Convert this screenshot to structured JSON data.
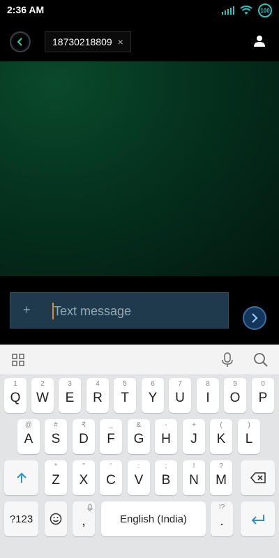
{
  "status": {
    "time": "2:36 AM",
    "battery": "100"
  },
  "header": {
    "recipient": "18730218809",
    "chip_close": "×"
  },
  "compose": {
    "attach": "+",
    "placeholder": "Text message"
  },
  "keyboard": {
    "row1": [
      {
        "main": "Q",
        "hint": "1"
      },
      {
        "main": "W",
        "hint": "2"
      },
      {
        "main": "E",
        "hint": "3"
      },
      {
        "main": "R",
        "hint": "4"
      },
      {
        "main": "T",
        "hint": "5"
      },
      {
        "main": "Y",
        "hint": "6"
      },
      {
        "main": "U",
        "hint": "7"
      },
      {
        "main": "I",
        "hint": "8"
      },
      {
        "main": "O",
        "hint": "9"
      },
      {
        "main": "P",
        "hint": "0"
      }
    ],
    "row2": [
      {
        "main": "A",
        "hint": "@"
      },
      {
        "main": "S",
        "hint": "#"
      },
      {
        "main": "D",
        "hint": "₹"
      },
      {
        "main": "F",
        "hint": "_"
      },
      {
        "main": "G",
        "hint": "&"
      },
      {
        "main": "H",
        "hint": "-"
      },
      {
        "main": "J",
        "hint": "+"
      },
      {
        "main": "K",
        "hint": "("
      },
      {
        "main": "L",
        "hint": ")"
      }
    ],
    "row3": [
      {
        "main": "Z",
        "hint": "*"
      },
      {
        "main": "X",
        "hint": "\""
      },
      {
        "main": "C",
        "hint": "'"
      },
      {
        "main": "V",
        "hint": ":"
      },
      {
        "main": "B",
        "hint": ";"
      },
      {
        "main": "N",
        "hint": "!"
      },
      {
        "main": "M",
        "hint": "?"
      }
    ],
    "symbols_key": "?123",
    "comma_key": ",",
    "space_key": "English (India)",
    "period_key": ".",
    "period_hint": "!?"
  }
}
